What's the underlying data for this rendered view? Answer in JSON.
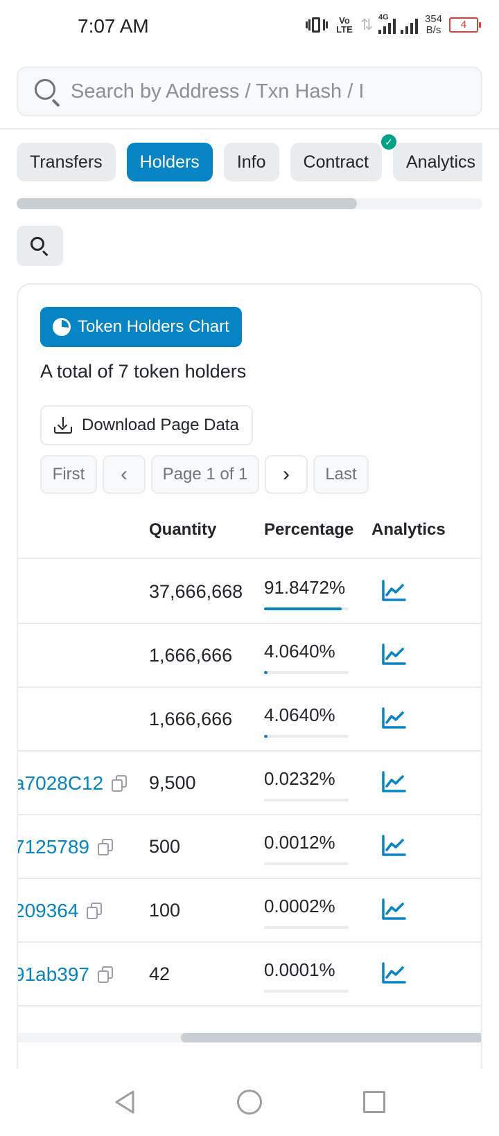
{
  "status_bar": {
    "time": "7:07 AM",
    "volte": "Vo\nLTE",
    "network": "4G",
    "speed_value": "354",
    "speed_unit": "B/s",
    "battery": "4"
  },
  "search": {
    "placeholder": "Search by Address / Txn Hash / I"
  },
  "tabs": [
    {
      "label": "Transfers",
      "active": false
    },
    {
      "label": "Holders",
      "active": true
    },
    {
      "label": "Info",
      "active": false
    },
    {
      "label": "Contract",
      "active": false,
      "verified": true
    },
    {
      "label": "Analytics",
      "active": false
    }
  ],
  "tabs_scroll_progress": 0.73,
  "card": {
    "chart_button": "Token Holders Chart",
    "total_text": "A total of 7 token holders",
    "download_button": "Download Page Data"
  },
  "pager": {
    "first": "First",
    "prev": "‹",
    "info": "Page 1 of 1",
    "next": "›",
    "last": "Last"
  },
  "table": {
    "headers": {
      "quantity": "Quantity",
      "percentage": "Percentage",
      "analytics": "Analytics"
    },
    "rows": [
      {
        "address": "",
        "quantity": "37,666,668",
        "percentage": "91.8472%",
        "share": 0.918472
      },
      {
        "address": "",
        "quantity": "1,666,666",
        "percentage": "4.0640%",
        "share": 0.04064
      },
      {
        "address": "",
        "quantity": "1,666,666",
        "percentage": "4.0640%",
        "share": 0.04064
      },
      {
        "address": "​a7028C12",
        "quantity": "9,500",
        "percentage": "0.0232%",
        "share": 0.000232
      },
      {
        "address": "7125789",
        "quantity": "500",
        "percentage": "0.0012%",
        "share": 1.2e-05
      },
      {
        "address": "209364",
        "quantity": "100",
        "percentage": "0.0002%",
        "share": 2e-06
      },
      {
        "address": "91ab397",
        "quantity": "42",
        "percentage": "0.0001%",
        "share": 1e-06
      }
    ]
  },
  "table_scroll": {
    "start": 0.35,
    "end": 1.0
  },
  "colors": {
    "accent": "#0784c3",
    "verified": "#00a186"
  }
}
